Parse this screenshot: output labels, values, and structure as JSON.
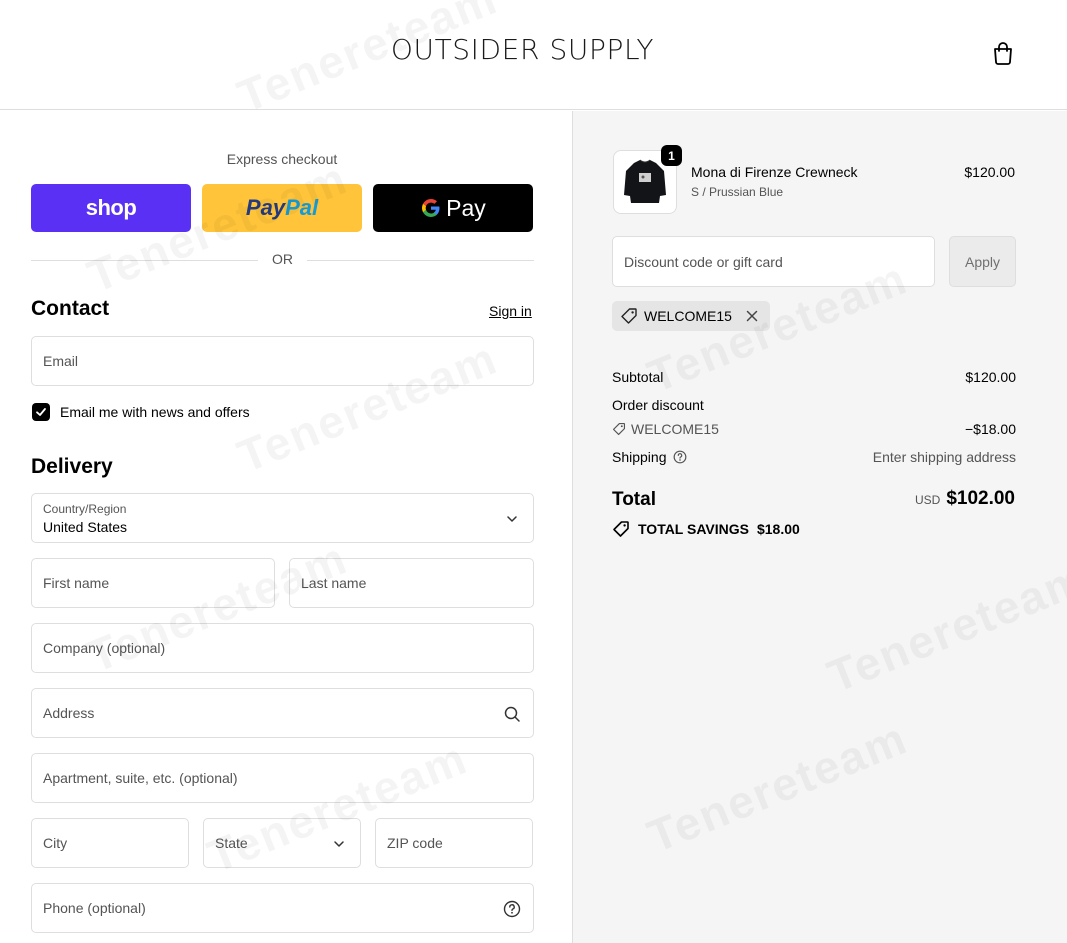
{
  "brand": "OUTSIDER SUPPLY",
  "express": {
    "title": "Express checkout",
    "shop_label": "shop",
    "paypal_label_1": "Pay",
    "paypal_label_2": "Pal",
    "gpay_label": "Pay",
    "or": "OR"
  },
  "contact": {
    "title": "Contact",
    "signin": "Sign in",
    "email_placeholder": "Email",
    "newsletter_label": "Email me with news and offers",
    "newsletter_checked": true
  },
  "delivery": {
    "title": "Delivery",
    "country_label": "Country/Region",
    "country_value": "United States",
    "first_name": "First name",
    "last_name": "Last name",
    "company": "Company (optional)",
    "address": "Address",
    "apartment": "Apartment, suite, etc. (optional)",
    "city": "City",
    "state": "State",
    "zip": "ZIP code",
    "phone": "Phone (optional)"
  },
  "order": {
    "item": {
      "name": "Mona di Firenze Crewneck",
      "variant": "S / Prussian Blue",
      "price": "$120.00",
      "quantity": "1"
    },
    "discount_placeholder": "Discount code or gift card",
    "apply_label": "Apply",
    "applied_code": "WELCOME15",
    "subtotal_label": "Subtotal",
    "subtotal_value": "$120.00",
    "order_discount_label": "Order discount",
    "discount_code": "WELCOME15",
    "discount_value": "−$18.00",
    "shipping_label": "Shipping",
    "shipping_value": "Enter shipping address",
    "total_label": "Total",
    "total_currency": "USD",
    "total_value": "$102.00",
    "savings_label": "TOTAL SAVINGS",
    "savings_value": "$18.00"
  },
  "watermark": "Tenereteam",
  "colors": {
    "shop": "#5a31f4",
    "paypal": "#ffc439",
    "gpay": "#000000",
    "summary_bg": "#f5f5f5"
  }
}
